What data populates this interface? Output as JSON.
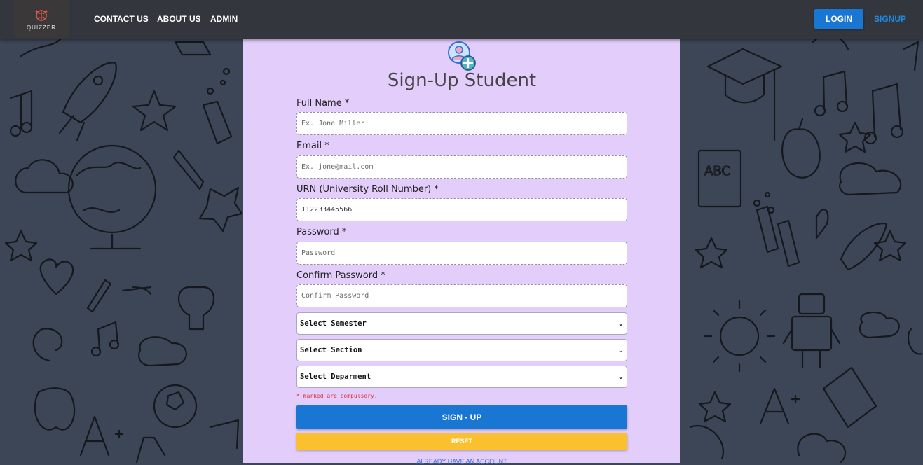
{
  "nav": {
    "logo_text": "QUIZZER",
    "links": [
      "CONTACT US",
      "ABOUT US",
      "ADMIN"
    ],
    "login_label": "LOGIN",
    "signup_label": "SIGNUP"
  },
  "form": {
    "title": "Sign-Up Student",
    "fields": [
      {
        "label": "Full Name *",
        "placeholder": "Ex. Jone Miller",
        "value": ""
      },
      {
        "label": "Email *",
        "placeholder": "Ex. jone@mail.com",
        "value": ""
      },
      {
        "label": "URN (University Roll Number) *",
        "placeholder": "",
        "value": "112233445566"
      },
      {
        "label": "Password *",
        "placeholder": "Password",
        "value": ""
      },
      {
        "label": "Confirm Password *",
        "placeholder": "Confirm Password",
        "value": ""
      }
    ],
    "selects": [
      {
        "value": "Select Semester"
      },
      {
        "value": "Select Section"
      },
      {
        "value": "Select Deparment"
      }
    ],
    "note": "* marked are compulsory.",
    "signup_button": "SIGN - UP",
    "reset_button": "RESET",
    "already_link": "ALREADY HAVE AN ACCOUNT"
  },
  "colors": {
    "navbar": "#33373d",
    "background": "#3d4656",
    "panel": "#e3cdfb",
    "primary": "#1976d2",
    "reset": "#fbc02d",
    "note": "#e03030"
  },
  "icons": {
    "logo": "brain-logo-icon",
    "form_header": "add-user-icon",
    "select_arrow": "chevron-down-icon"
  }
}
